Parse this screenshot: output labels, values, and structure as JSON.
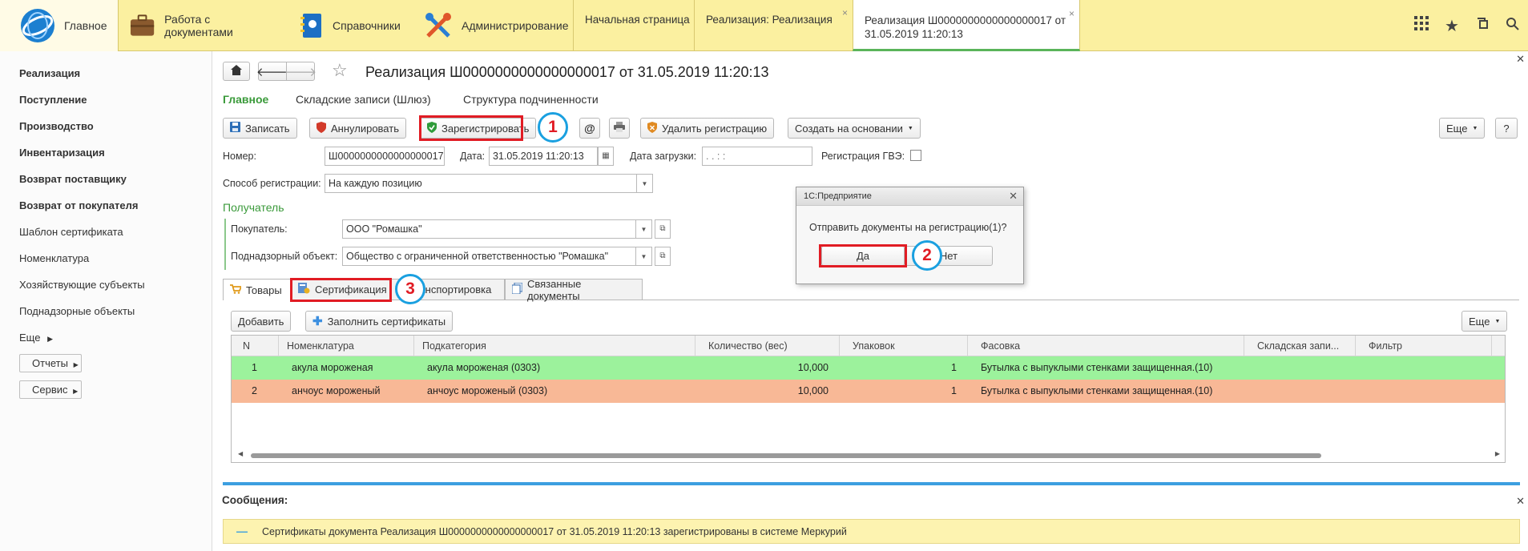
{
  "topbar": {
    "sections": [
      {
        "label": "Главное",
        "icon": "logo-icon"
      },
      {
        "label": "Работа с документами",
        "icon": "briefcase-icon"
      },
      {
        "label": "Справочники",
        "icon": "book-icon"
      },
      {
        "label": "Администрирование",
        "icon": "tools-icon"
      }
    ],
    "tabs": [
      {
        "label": "Начальная страница"
      },
      {
        "label": "Реализация: Реализация",
        "close": "×"
      },
      {
        "label_line1": "Реализация Ш0000000000000000017 от",
        "label_line2": "31.05.2019 11:20:13",
        "close": "×"
      }
    ],
    "icons": [
      "grid-icon",
      "star-icon",
      "history-icon",
      "search-icon"
    ]
  },
  "sidebar": {
    "items": [
      {
        "label": "Реализация",
        "bold": true
      },
      {
        "label": "Поступление",
        "bold": true
      },
      {
        "label": "Производство",
        "bold": true
      },
      {
        "label": "Инвентаризация",
        "bold": true
      },
      {
        "label": "Возврат поставщику",
        "bold": true
      },
      {
        "label": "Возврат от покупателя",
        "bold": true
      },
      {
        "label": "Шаблон сертификата",
        "bold": false
      },
      {
        "label": "Номенклатура",
        "bold": false
      },
      {
        "label": "Хозяйствующие субъекты",
        "bold": false
      },
      {
        "label": "Поднадзорные объекты",
        "bold": false
      }
    ],
    "more": "Еще",
    "reports": "Отчеты",
    "service": "Сервис"
  },
  "form": {
    "title": "Реализация Ш0000000000000000017 от 31.05.2019 11:20:13",
    "nav_tabs": [
      "Главное",
      "Складские записи (Шлюз)",
      "Структура подчиненности"
    ],
    "toolbar": {
      "save": "Записать",
      "cancel": "Аннулировать",
      "register": "Зарегистрировать",
      "at": "@",
      "delete_reg": "Удалить регистрацию",
      "create_based": "Создать на основании",
      "more": "Еще",
      "help": "?"
    },
    "fields": {
      "number_label": "Номер:",
      "number_value": "Ш0000000000000000017",
      "date_label": "Дата:",
      "date_value": "31.05.2019 11:20:13",
      "load_date_label": "Дата загрузки:",
      "load_date_value": " .  .       :  :",
      "gve_label": "Регистрация ГВЭ:",
      "reg_method_label": "Способ регистрации:",
      "reg_method_value": "На каждую позицию",
      "recipient_group": "Получатель",
      "buyer_label": "Покупатель:",
      "buyer_value": "ООО \"Ромашка\"",
      "supervised_label": "Поднадзорный объект:",
      "supervised_value": "Общество с ограниченной ответственностью  \"Ромашка\""
    },
    "tabs": [
      "Товары",
      "Сертификация",
      "Транспортировка",
      "Связанные документы"
    ],
    "table_toolbar": {
      "add": "Добавить",
      "fill_certs": "Заполнить сертификаты",
      "more": "Еще"
    },
    "table": {
      "columns": [
        "N",
        "Номенклатура",
        "Подкатегория",
        "Количество (вес)",
        "Упаковок",
        "Фасовка",
        "Складская запи...",
        "Фильтр"
      ],
      "rows": [
        {
          "n": "1",
          "nom": "акула мороженая",
          "sub": "акула мороженая (0303)",
          "qty": "10,000",
          "packs": "1",
          "pack": "Бутылка с выпуклыми стенками защищенная.(10)",
          "color": "#9cf29c"
        },
        {
          "n": "2",
          "nom": "анчоус мороженый",
          "sub": "анчоус мороженый (0303)",
          "qty": "10,000",
          "packs": "1",
          "pack": "Бутылка с выпуклыми стенками защищенная.(10)",
          "color": "#f8b896"
        }
      ]
    },
    "messages": {
      "title": "Сообщения:",
      "text": "Сертификаты документа Реализация Ш0000000000000000017 от 31.05.2019 11:20:13 зарегистрированы в системе Меркурий"
    }
  },
  "dialog": {
    "title": "1С:Предприятие",
    "question": "Отправить документы на регистрацию(1)?",
    "yes": "Да",
    "no": "Нет"
  },
  "annotations": {
    "one": "1",
    "two": "2",
    "three": "3"
  },
  "colors": {
    "highlight": "#e11c24",
    "circle": "#1aa0e0",
    "accent_green": "#3a9a3a",
    "row1": "#9cf29c",
    "row2": "#f8b896"
  }
}
